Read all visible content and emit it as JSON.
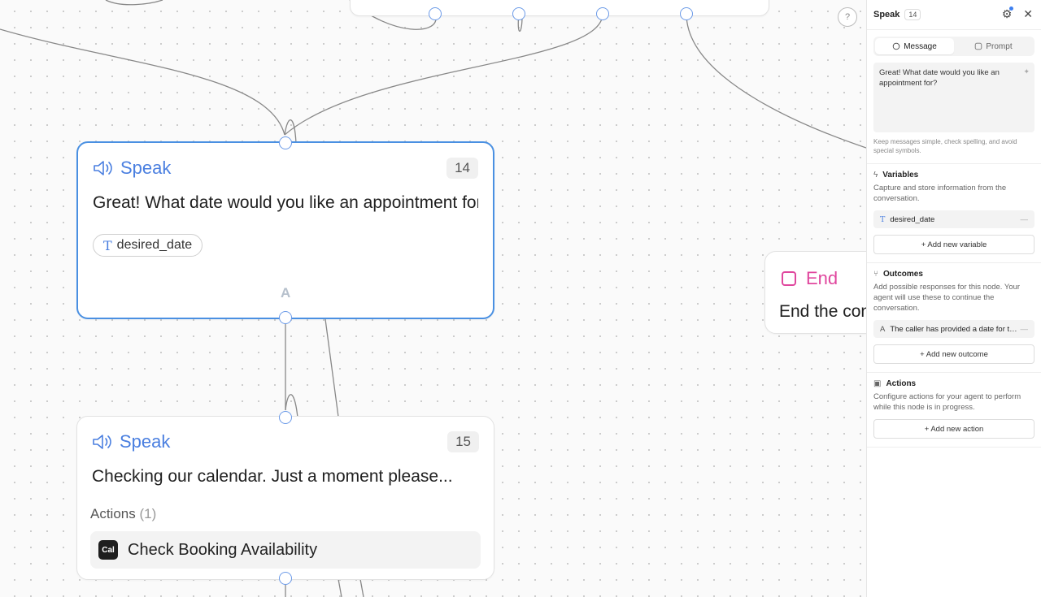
{
  "canvas": {
    "help_icon": "question-icon",
    "node_main": {
      "type_label": "Speak",
      "count": "14",
      "message": "Great! What date would you like an appointment for?",
      "variable_chip": "desired_date",
      "branch_letter": "A"
    },
    "node_next": {
      "type_label": "Speak",
      "count": "15",
      "message": "Checking our calendar. Just a moment please...",
      "actions_label": "Actions",
      "actions_count": "(1)",
      "action_logo": "Cal",
      "action_name": "Check Booking Availability"
    },
    "node_end": {
      "type_label": "End",
      "message": "End the conversation"
    }
  },
  "panel": {
    "title": "Speak",
    "count": "14",
    "tabs": [
      {
        "label": "Message",
        "active": true
      },
      {
        "label": "Prompt",
        "active": false
      }
    ],
    "message_text": "Great!  What date would you like an appointment for?",
    "message_hint": "Keep messages simple, check spelling, and avoid special symbols.",
    "variables": {
      "title": "Variables",
      "description": "Capture and store information from the conversation.",
      "items": [
        "desired_date"
      ],
      "add_label": "+ Add new variable"
    },
    "outcomes": {
      "title": "Outcomes",
      "description": "Add possible responses for this node. Your agent will use these to continue the conversation.",
      "items": [
        {
          "letter": "A",
          "text": "The caller has provided a date for the appointment"
        }
      ],
      "add_label": "+ Add new outcome"
    },
    "actions": {
      "title": "Actions",
      "description": "Configure actions for your agent to perform while this node is in progress.",
      "add_label": "+ Add new action"
    }
  },
  "colors": {
    "accent_blue": "#4a7fe0",
    "selected_border": "#4a90e2",
    "end_pink": "#e0479e"
  }
}
